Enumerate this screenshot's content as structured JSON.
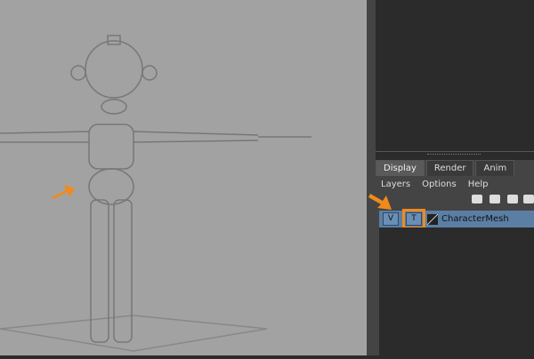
{
  "tabs": [
    "Display",
    "Render",
    "Anim"
  ],
  "menu": [
    "Layers",
    "Options",
    "Help"
  ],
  "layer": {
    "visible": "V",
    "template": "T",
    "name": "CharacterMesh"
  },
  "colors": {
    "accent": "#f08a1c",
    "selected": "#5b7fa4"
  }
}
